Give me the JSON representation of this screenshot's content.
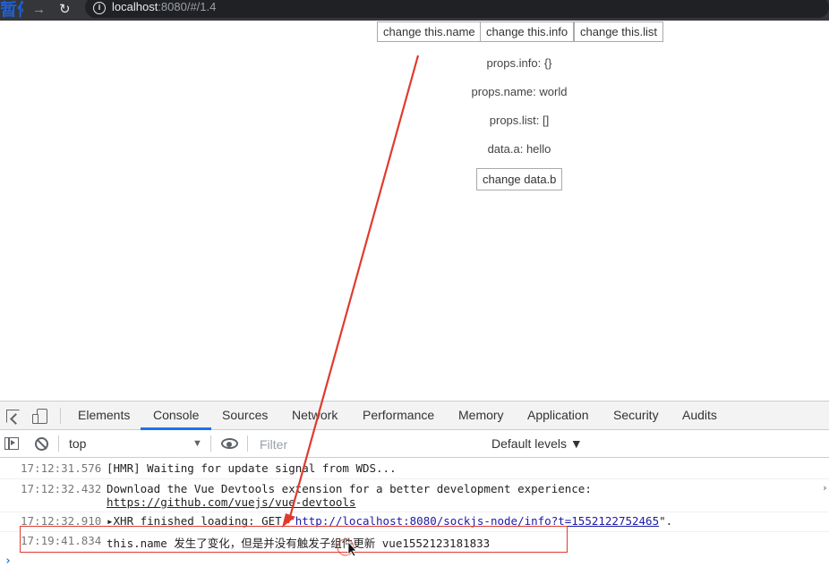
{
  "browser": {
    "paused_label": "暂停",
    "forward_icon": "arrow-right-icon",
    "reload_icon": "reload-icon",
    "url_host": "localhost",
    "url_rest": ":8080/#/1.4"
  },
  "page": {
    "buttons": [
      "change this.name",
      "change this.info",
      "change this.list"
    ],
    "lines": {
      "info": "props.info: {}",
      "name": "props.name: world",
      "list": "props.list: []",
      "data_a": "data.a: hello"
    },
    "change_b_label": "change data.b"
  },
  "devtools": {
    "tabs": [
      "Elements",
      "Console",
      "Sources",
      "Network",
      "Performance",
      "Memory",
      "Application",
      "Security",
      "Audits"
    ],
    "active_tab": "Console",
    "context": "top",
    "filter_placeholder": "Filter",
    "levels": "Default levels ▼",
    "logs": [
      {
        "time": "17:12:31.576",
        "text": "[HMR] Waiting for update signal from WDS..."
      },
      {
        "time": "17:12:32.432",
        "text": "Download the Vue Devtools extension for a better development experience:",
        "link": "https://github.com/vuejs/vue-devtools"
      },
      {
        "time": "17:12:32.910",
        "prefix": "▸XHR finished loading: GET \"",
        "url": "http://localhost:8080/sockjs-node/info?t=1552122752465",
        "suffix": "\"."
      },
      {
        "time": "17:19:41.834",
        "text": "this.name 发生了变化，但是并没有触发子组件更新 vue1552123181833"
      }
    ],
    "prompt": "›"
  },
  "annotation": {
    "color": "#e03a2f"
  }
}
